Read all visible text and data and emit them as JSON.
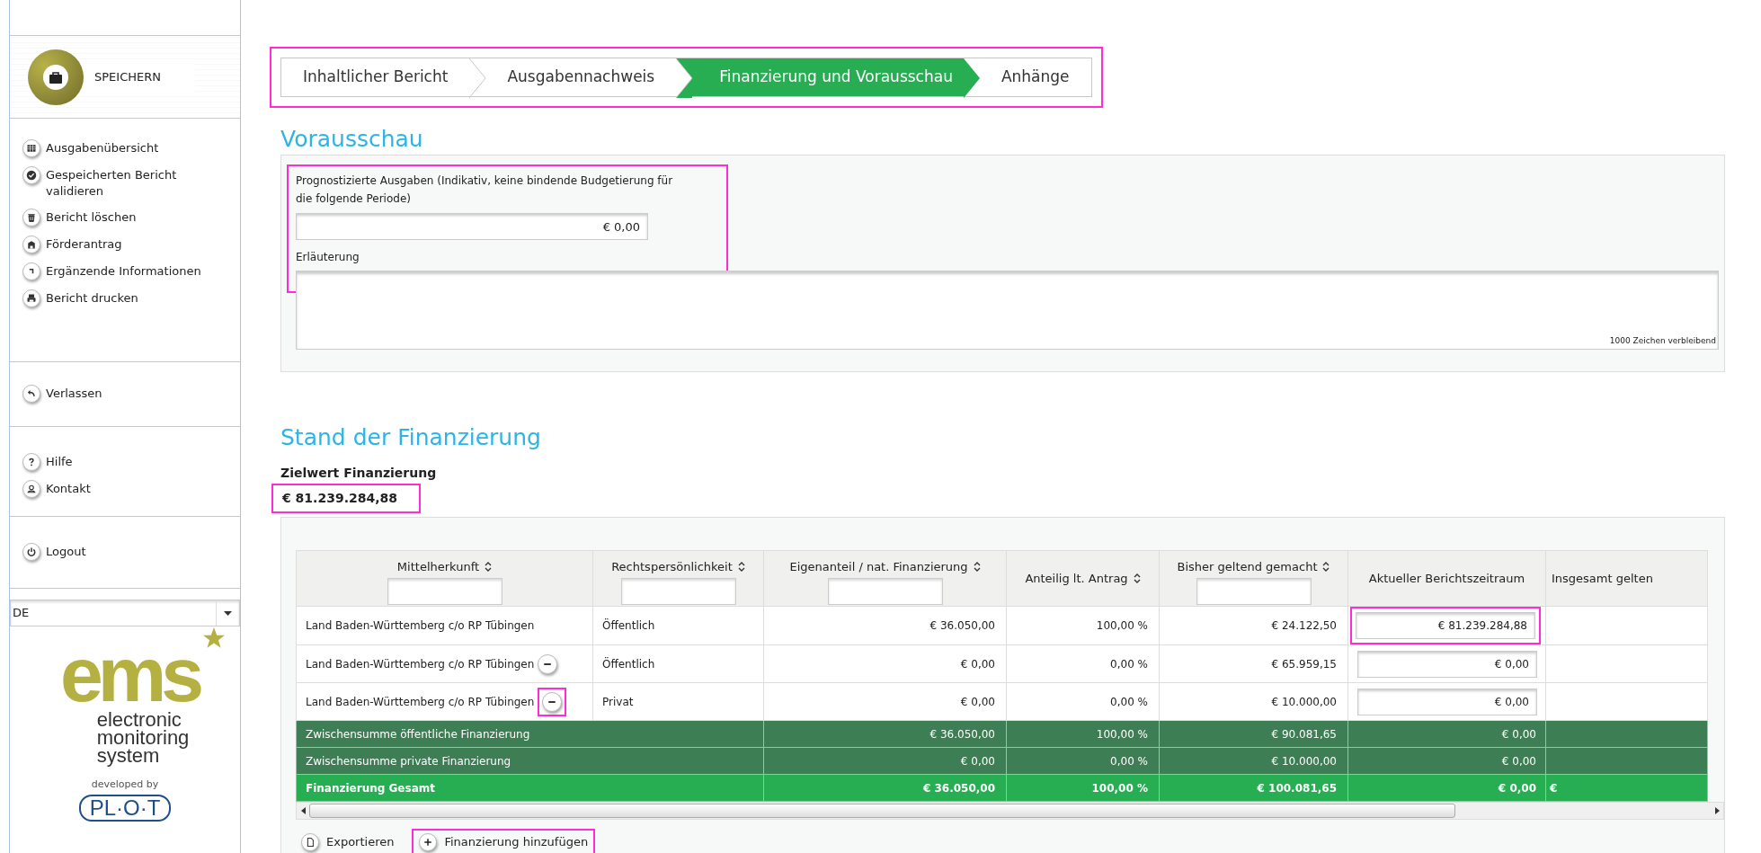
{
  "sidebar": {
    "save_button": "SPEICHERN",
    "groups": [
      [
        {
          "label": "Ausgabenübersicht"
        },
        {
          "label": "Gespeicherten Bericht validieren"
        },
        {
          "label": "Bericht löschen"
        },
        {
          "label": "Förderantrag"
        },
        {
          "label": "Ergänzende Informationen"
        },
        {
          "label": "Bericht drucken"
        }
      ],
      [
        {
          "label": "Verlassen"
        }
      ],
      [
        {
          "label": "Hilfe"
        },
        {
          "label": "Kontakt"
        }
      ],
      [
        {
          "label": "Logout"
        }
      ]
    ],
    "language": "DE",
    "logo": {
      "mark": "ems",
      "lines": [
        "electronic",
        "monitoring",
        "system"
      ],
      "developed_by": "developed by",
      "company": "PL·O·T"
    }
  },
  "steps": [
    {
      "label": "Inhaltlicher Bericht",
      "selected": false
    },
    {
      "label": "Ausgabennachweis",
      "selected": false
    },
    {
      "label": "Finanzierung und Vorausschau",
      "selected": true
    },
    {
      "label": "Anhänge",
      "selected": false
    }
  ],
  "forecast": {
    "title": "Vorausschau",
    "amount_label": "Prognostizierte Ausgaben (Indikativ, keine bindende Budgetierung für die folgende Periode)",
    "amount_value": "€ 0,00",
    "note_label": "Erläuterung",
    "note_counter": "1000 Zeichen verbleibend"
  },
  "financing": {
    "title": "Stand der Finanzierung",
    "target_label": "Zielwert Finanzierung",
    "target_value": "€ 81.239.284,88",
    "table": {
      "columns": [
        {
          "label": "Mittelherkunft",
          "sortable": true,
          "filter": true
        },
        {
          "label": "Rechtspersönlichkeit",
          "sortable": true,
          "filter": true
        },
        {
          "label": "Eigenanteil / nat. Finanzierung",
          "sortable": true,
          "filter": true
        },
        {
          "label": "Anteilig lt. Antrag",
          "sortable": true,
          "filter": false
        },
        {
          "label": "Bisher geltend gemacht",
          "sortable": true,
          "filter": true
        },
        {
          "label": "Aktueller Berichtszeitraum",
          "sortable": false,
          "filter": false
        },
        {
          "label": "Insgesamt gelten",
          "sortable": false,
          "filter": false
        }
      ],
      "rows": [
        {
          "kind": "entry",
          "source": "Land Baden-Württemberg c/o RP Tübingen",
          "removable": false,
          "legal": "Öffentlich",
          "own": "€ 36.050,00",
          "share": "100,00 %",
          "claimed": "€ 24.122,50",
          "current": "€ 81.239.284,88"
        },
        {
          "kind": "entry",
          "source": "Land Baden-Württemberg c/o RP Tübingen",
          "removable": true,
          "legal": "Öffentlich",
          "own": "€ 0,00",
          "share": "0,00 %",
          "claimed": "€ 65.959,15",
          "current": "€ 0,00"
        },
        {
          "kind": "entry",
          "source": "Land Baden-Württemberg c/o RP Tübingen",
          "removable": true,
          "legal": "Privat",
          "own": "€ 0,00",
          "share": "0,00 %",
          "claimed": "€ 10.000,00",
          "current": "€ 0,00"
        },
        {
          "kind": "subtotal",
          "source": "Zwischensumme öffentliche Finanzierung",
          "own": "€ 36.050,00",
          "share": "100,00 %",
          "claimed": "€ 90.081,65",
          "current": "€ 0,00"
        },
        {
          "kind": "subtotal",
          "source": "Zwischensumme private Finanzierung",
          "own": "€ 0,00",
          "share": "0,00 %",
          "claimed": "€ 10.000,00",
          "current": "€ 0,00"
        },
        {
          "kind": "total",
          "source": "Finanzierung Gesamt",
          "own": "€ 36.050,00",
          "share": "100,00 %",
          "claimed": "€ 100.081,65",
          "current": "€ 0,00",
          "overall": "€"
        }
      ]
    },
    "actions": [
      {
        "label": "Exportieren"
      },
      {
        "label": "Finanzierung hinzufügen"
      }
    ]
  }
}
